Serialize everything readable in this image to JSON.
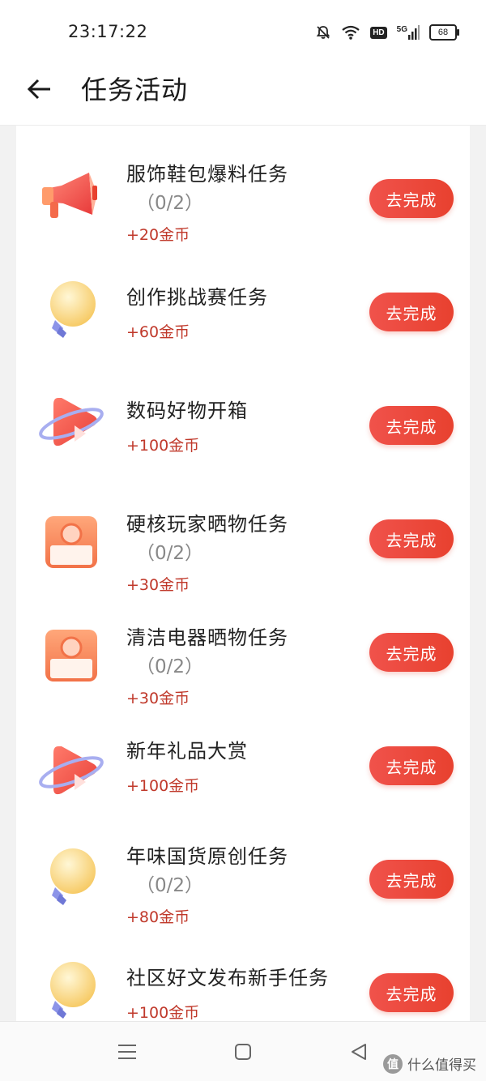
{
  "status_bar": {
    "time": "23:17:22",
    "battery": "68",
    "hd": "HD",
    "net": "5G",
    "icons": [
      "bell-muted-icon",
      "wifi-icon",
      "hd-icon",
      "signal-5g-icon",
      "battery-icon"
    ]
  },
  "header": {
    "title": "任务活动",
    "back_icon": "arrow-left-icon"
  },
  "tasks": [
    {
      "title": "服饰鞋包爆料任务",
      "progress": "（0/2）",
      "reward": "+20金币",
      "button": "去完成",
      "icon": "megaphone-icon"
    },
    {
      "title": "创作挑战赛任务",
      "progress": "",
      "reward": "+60金币",
      "button": "去完成",
      "icon": "lightbulb-icon"
    },
    {
      "title": "数码好物开箱",
      "progress": "",
      "reward": "+100金币",
      "button": "去完成",
      "icon": "play-video-icon"
    },
    {
      "title": "硬核玩家晒物任务",
      "progress": "（0/2）",
      "reward": "+30金币",
      "button": "去完成",
      "icon": "camera-photo-icon"
    },
    {
      "title": "清洁电器晒物任务",
      "progress": "（0/2）",
      "reward": "+30金币",
      "button": "去完成",
      "icon": "camera-photo-icon"
    },
    {
      "title": "新年礼品大赏",
      "progress": "",
      "reward": "+100金币",
      "button": "去完成",
      "icon": "play-video-icon"
    },
    {
      "title": "年味国货原创任务",
      "progress": "（0/2）",
      "reward": "+80金币",
      "button": "去完成",
      "icon": "lightbulb-icon"
    },
    {
      "title": "社区好文发布新手任务",
      "progress": "",
      "reward": "+100金币",
      "button": "去完成",
      "icon": "lightbulb-icon"
    }
  ],
  "nav_bar": {
    "icons": [
      "menu-icon",
      "home-square-icon",
      "back-triangle-icon"
    ]
  },
  "watermark": {
    "logo": "值",
    "text": "什么值得买"
  },
  "colors": {
    "accent": "#e8412f",
    "reward_text": "#c0392b"
  }
}
